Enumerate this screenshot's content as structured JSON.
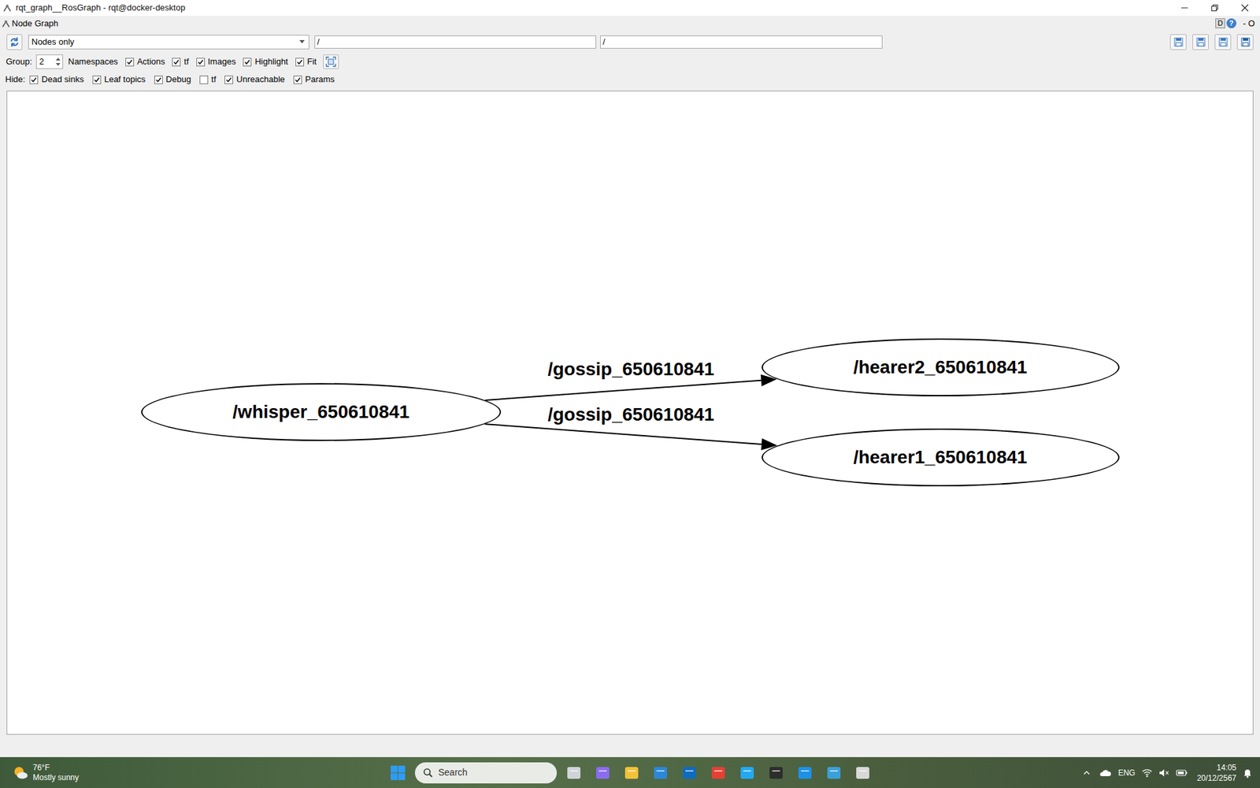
{
  "window": {
    "title": "rqt_graph__RosGraph - rqt@docker-desktop"
  },
  "plugin_bar": {
    "title": "Node Graph",
    "buttons": [
      "D",
      "?"
    ],
    "controls": "- O"
  },
  "toolbar": {
    "mode": "Nodes only",
    "node_filter": "/",
    "topic_filter": "/"
  },
  "group": {
    "label": "Group:",
    "value": "2",
    "namespaces_label": "Namespaces",
    "options": [
      {
        "label": "Actions",
        "checked": true
      },
      {
        "label": "tf",
        "checked": true
      },
      {
        "label": "Images",
        "checked": true
      },
      {
        "label": "Highlight",
        "checked": true
      },
      {
        "label": "Fit",
        "checked": true
      }
    ]
  },
  "hide": {
    "label": "Hide:",
    "options": [
      {
        "label": "Dead sinks",
        "checked": true
      },
      {
        "label": "Leaf topics",
        "checked": true
      },
      {
        "label": "Debug",
        "checked": true
      },
      {
        "label": "tf",
        "checked": false
      },
      {
        "label": "Unreachable",
        "checked": true
      },
      {
        "label": "Params",
        "checked": true
      }
    ]
  },
  "graph": {
    "nodes": [
      {
        "label": "/whisper_650610841"
      },
      {
        "label": "/hearer2_650610841"
      },
      {
        "label": "/hearer1_650610841"
      }
    ],
    "edges": [
      {
        "from": 0,
        "to": 1,
        "label": "/gossip_650610841"
      },
      {
        "from": 0,
        "to": 2,
        "label": "/gossip_650610841"
      }
    ]
  },
  "taskbar": {
    "weather": {
      "temp": "76°F",
      "summary": "Mostly sunny"
    },
    "search": {
      "placeholder": "Search"
    },
    "language": "ENG",
    "time": "14:05",
    "date": "20/12/2567"
  }
}
